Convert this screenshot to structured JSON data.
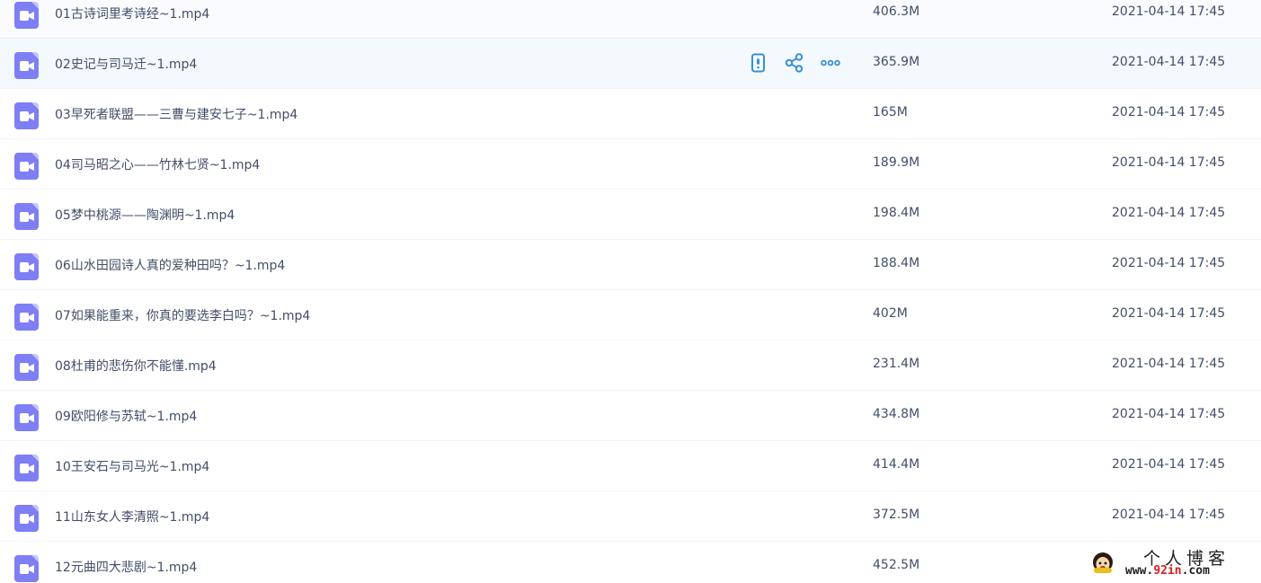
{
  "files": [
    {
      "name": "01古诗词里考诗经~1.mp4",
      "size": "406.3M",
      "date": "2021-04-14 17:45"
    },
    {
      "name": "02史记与司马迁~1.mp4",
      "size": "365.9M",
      "date": "2021-04-14 17:45"
    },
    {
      "name": "03早死者联盟——三曹与建安七子~1.mp4",
      "size": "165M",
      "date": "2021-04-14 17:45"
    },
    {
      "name": "04司马昭之心——竹林七贤~1.mp4",
      "size": "189.9M",
      "date": "2021-04-14 17:45"
    },
    {
      "name": "05梦中桃源——陶渊明~1.mp4",
      "size": "198.4M",
      "date": "2021-04-14 17:45"
    },
    {
      "name": "06山水田园诗人真的爱种田吗？~1.mp4",
      "size": "188.4M",
      "date": "2021-04-14 17:45"
    },
    {
      "name": "07如果能重来，你真的要选李白吗？~1.mp4",
      "size": "402M",
      "date": "2021-04-14 17:45"
    },
    {
      "name": "08杜甫的悲伤你不能懂.mp4",
      "size": "231.4M",
      "date": "2021-04-14 17:45"
    },
    {
      "name": "09欧阳修与苏轼~1.mp4",
      "size": "434.8M",
      "date": "2021-04-14 17:45"
    },
    {
      "name": "10王安石与司马光~1.mp4",
      "size": "414.4M",
      "date": "2021-04-14 17:45"
    },
    {
      "name": "11山东女人李清照~1.mp4",
      "size": "372.5M",
      "date": "2021-04-14 17:45"
    },
    {
      "name": "12元曲四大悲剧~1.mp4",
      "size": "452.5M",
      "date": ""
    }
  ],
  "hover_actions": {
    "row_index": 1,
    "icons": [
      "mobile-phone-icon",
      "share-icon",
      "more-dots-icon"
    ]
  },
  "watermark": {
    "title": "个人博客",
    "url_prefix": "www.",
    "url_accent": "92in",
    "url_suffix": ".com"
  },
  "colors": {
    "file_icon": "#7e7ef5",
    "action_icon": "#3a8fd8",
    "text": "#424e67",
    "hover_row_bg": "#f4f9fe"
  }
}
